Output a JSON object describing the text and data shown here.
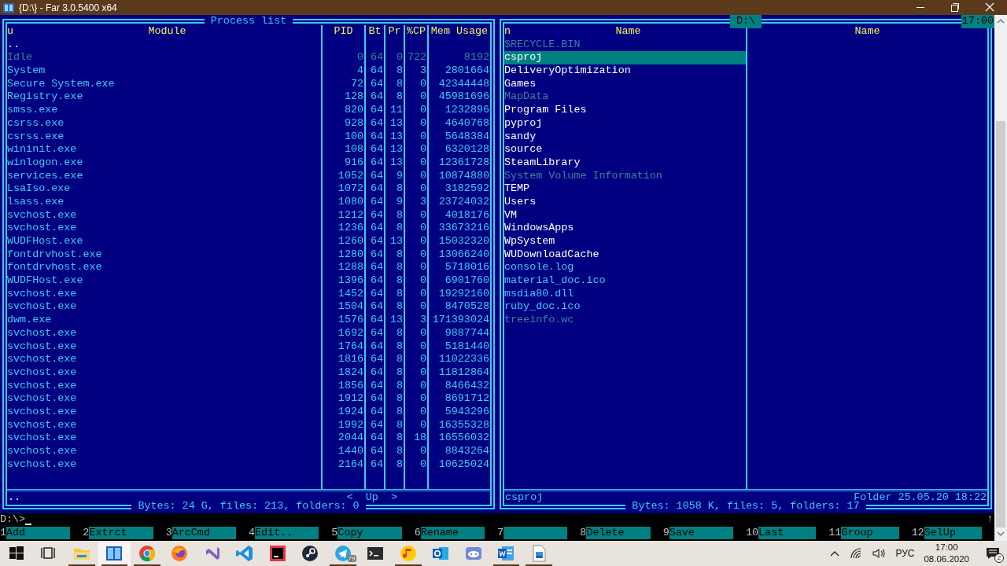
{
  "window": {
    "title": "{D:\\} - Far 3.0.5400 x64"
  },
  "left_panel": {
    "title": "Process list",
    "active": false,
    "columns": [
      {
        "label": "Module",
        "sort_mark": "u"
      },
      {
        "label": "PID"
      },
      {
        "label": "Bt"
      },
      {
        "label": "Pr"
      },
      {
        "label": "%CP"
      },
      {
        "label": "Mem Usage"
      }
    ],
    "rows": [
      {
        "kind": "up",
        "dim": false,
        "cells": [
          ".."
        ]
      },
      {
        "kind": "process",
        "dim": true,
        "cells": [
          "Idle",
          "0",
          "64",
          "0",
          "722",
          "8192"
        ]
      },
      {
        "kind": "process",
        "dim": false,
        "cells": [
          "System",
          "4",
          "64",
          "8",
          "3",
          "2801664"
        ]
      },
      {
        "kind": "process",
        "dim": false,
        "cells": [
          "Secure System.exe",
          "72",
          "64",
          "8",
          "0",
          "42344448"
        ]
      },
      {
        "kind": "process",
        "dim": false,
        "cells": [
          "Registry.exe",
          "128",
          "64",
          "8",
          "0",
          "45981696"
        ]
      },
      {
        "kind": "process",
        "dim": false,
        "cells": [
          "smss.exe",
          "820",
          "64",
          "11",
          "0",
          "1232896"
        ]
      },
      {
        "kind": "process",
        "dim": false,
        "cells": [
          "csrss.exe",
          "928",
          "64",
          "13",
          "0",
          "4640768"
        ]
      },
      {
        "kind": "process",
        "dim": false,
        "cells": [
          "csrss.exe",
          "100",
          "64",
          "13",
          "0",
          "5648384"
        ]
      },
      {
        "kind": "process",
        "dim": false,
        "cells": [
          "wininit.exe",
          "108",
          "64",
          "13",
          "0",
          "6320128"
        ]
      },
      {
        "kind": "process",
        "dim": false,
        "cells": [
          "winlogon.exe",
          "916",
          "64",
          "13",
          "0",
          "12361728"
        ]
      },
      {
        "kind": "process",
        "dim": false,
        "cells": [
          "services.exe",
          "1052",
          "64",
          "9",
          "0",
          "10874880"
        ]
      },
      {
        "kind": "process",
        "dim": false,
        "cells": [
          "LsaIso.exe",
          "1072",
          "64",
          "8",
          "0",
          "3182592"
        ]
      },
      {
        "kind": "process",
        "dim": false,
        "cells": [
          "lsass.exe",
          "1080",
          "64",
          "9",
          "3",
          "23724032"
        ]
      },
      {
        "kind": "process",
        "dim": false,
        "cells": [
          "svchost.exe",
          "1212",
          "64",
          "8",
          "0",
          "4018176"
        ]
      },
      {
        "kind": "process",
        "dim": false,
        "cells": [
          "svchost.exe",
          "1236",
          "64",
          "8",
          "0",
          "33673216"
        ]
      },
      {
        "kind": "process",
        "dim": false,
        "cells": [
          "WUDFHost.exe",
          "1260",
          "64",
          "13",
          "0",
          "15032320"
        ]
      },
      {
        "kind": "process",
        "dim": false,
        "cells": [
          "fontdrvhost.exe",
          "1280",
          "64",
          "8",
          "0",
          "13066240"
        ]
      },
      {
        "kind": "process",
        "dim": false,
        "cells": [
          "fontdrvhost.exe",
          "1288",
          "64",
          "8",
          "0",
          "5718016"
        ]
      },
      {
        "kind": "process",
        "dim": false,
        "cells": [
          "WUDFHost.exe",
          "1396",
          "64",
          "8",
          "0",
          "6901760"
        ]
      },
      {
        "kind": "process",
        "dim": false,
        "cells": [
          "svchost.exe",
          "1452",
          "64",
          "8",
          "0",
          "19292160"
        ]
      },
      {
        "kind": "process",
        "dim": false,
        "cells": [
          "svchost.exe",
          "1504",
          "64",
          "8",
          "0",
          "8470528"
        ]
      },
      {
        "kind": "process",
        "dim": false,
        "cells": [
          "dwm.exe",
          "1576",
          "64",
          "13",
          "3",
          "171393024"
        ]
      },
      {
        "kind": "process",
        "dim": false,
        "cells": [
          "svchost.exe",
          "1692",
          "64",
          "8",
          "0",
          "9887744"
        ]
      },
      {
        "kind": "process",
        "dim": false,
        "cells": [
          "svchost.exe",
          "1764",
          "64",
          "8",
          "0",
          "5181440"
        ]
      },
      {
        "kind": "process",
        "dim": false,
        "cells": [
          "svchost.exe",
          "1816",
          "64",
          "8",
          "0",
          "11022336"
        ]
      },
      {
        "kind": "process",
        "dim": false,
        "cells": [
          "svchost.exe",
          "1824",
          "64",
          "8",
          "0",
          "11812864"
        ]
      },
      {
        "kind": "process",
        "dim": false,
        "cells": [
          "svchost.exe",
          "1856",
          "64",
          "8",
          "0",
          "8466432"
        ]
      },
      {
        "kind": "process",
        "dim": false,
        "cells": [
          "svchost.exe",
          "1912",
          "64",
          "8",
          "0",
          "8691712"
        ]
      },
      {
        "kind": "process",
        "dim": false,
        "cells": [
          "svchost.exe",
          "1924",
          "64",
          "8",
          "0",
          "5943296"
        ]
      },
      {
        "kind": "process",
        "dim": false,
        "cells": [
          "svchost.exe",
          "1992",
          "64",
          "8",
          "0",
          "16355328"
        ]
      },
      {
        "kind": "process",
        "dim": false,
        "cells": [
          "svchost.exe",
          "2044",
          "64",
          "8",
          "18",
          "16556032"
        ]
      },
      {
        "kind": "process",
        "dim": false,
        "cells": [
          "svchost.exe",
          "1440",
          "64",
          "8",
          "0",
          "8843264"
        ]
      },
      {
        "kind": "process",
        "dim": false,
        "cells": [
          "svchost.exe",
          "2164",
          "64",
          "8",
          "0",
          "10625024"
        ]
      }
    ],
    "status": {
      "name": "..",
      "nav": "<  Up  >"
    },
    "totals": "Bytes: 24 G, files: 213, folders: 0"
  },
  "right_panel": {
    "title": "D:\\",
    "active": true,
    "columns": [
      {
        "label": "Name",
        "sort_mark": "n"
      },
      {
        "label": "Name"
      }
    ],
    "items": [
      {
        "name": "$RECYCLE.BIN",
        "kind": "folder",
        "dim": true,
        "selected": false
      },
      {
        "name": "csproj",
        "kind": "folder",
        "dim": false,
        "selected": true
      },
      {
        "name": "DeliveryOptimization",
        "kind": "folder",
        "dim": false,
        "selected": false
      },
      {
        "name": "Games",
        "kind": "folder",
        "dim": false,
        "selected": false
      },
      {
        "name": "MapData",
        "kind": "folder",
        "dim": true,
        "selected": false
      },
      {
        "name": "Program Files",
        "kind": "folder",
        "dim": false,
        "selected": false
      },
      {
        "name": "pyproj",
        "kind": "folder",
        "dim": false,
        "selected": false
      },
      {
        "name": "sandy",
        "kind": "folder",
        "dim": false,
        "selected": false
      },
      {
        "name": "source",
        "kind": "folder",
        "dim": false,
        "selected": false
      },
      {
        "name": "SteamLibrary",
        "kind": "folder",
        "dim": false,
        "selected": false
      },
      {
        "name": "System Volume Information",
        "kind": "folder",
        "dim": true,
        "selected": false
      },
      {
        "name": "TEMP",
        "kind": "folder",
        "dim": false,
        "selected": false
      },
      {
        "name": "Users",
        "kind": "folder",
        "dim": false,
        "selected": false
      },
      {
        "name": "VM",
        "kind": "folder",
        "dim": false,
        "selected": false
      },
      {
        "name": "WindowsApps",
        "kind": "folder",
        "dim": false,
        "selected": false
      },
      {
        "name": "WpSystem",
        "kind": "folder",
        "dim": false,
        "selected": false
      },
      {
        "name": "WUDownloadCache",
        "kind": "folder",
        "dim": false,
        "selected": false
      },
      {
        "name": "console.log",
        "kind": "file",
        "dim": false,
        "selected": false
      },
      {
        "name": "material_doc.ico",
        "kind": "file",
        "dim": false,
        "selected": false
      },
      {
        "name": "msdia80.dll",
        "kind": "file",
        "dim": false,
        "selected": false
      },
      {
        "name": "ruby_doc.ico",
        "kind": "file",
        "dim": false,
        "selected": false
      },
      {
        "name": "treeinfo.wc",
        "kind": "file",
        "dim": true,
        "selected": false
      }
    ],
    "status": {
      "name": "csproj",
      "info": "Folder 25.05.20 18:22"
    },
    "totals": "Bytes: 1058 K, files: 5, folders: 17"
  },
  "clock": "17:00",
  "command_line": {
    "prompt": "D:\\>",
    "scroll_mark": "↑"
  },
  "keybar": [
    {
      "key": "1",
      "label": "Add"
    },
    {
      "key": "2",
      "label": "Extrct"
    },
    {
      "key": "3",
      "label": "ArcCmd"
    },
    {
      "key": "4",
      "label": "Edit.."
    },
    {
      "key": "5",
      "label": "Copy"
    },
    {
      "key": "6",
      "label": "Rename"
    },
    {
      "key": "7"
    },
    {
      "key": "8",
      "label": "Delete"
    },
    {
      "key": "9",
      "label": "Save"
    },
    {
      "key": "10",
      "label": "Last"
    },
    {
      "key": "11",
      "label": "Group"
    },
    {
      "key": "12",
      "label": "SelUp"
    }
  ],
  "taskbar": {
    "apps": [
      {
        "kind": "start",
        "running": false,
        "active": false
      },
      {
        "kind": "task-view",
        "running": false,
        "active": false
      },
      {
        "kind": "folder",
        "running": true,
        "active": false
      },
      {
        "kind": "panels",
        "running": true,
        "active": true
      },
      {
        "kind": "ring-circle",
        "running": true,
        "active": false
      },
      {
        "kind": "swirl-circle",
        "running": false,
        "active": false
      },
      {
        "kind": "ribbon-violet",
        "running": false,
        "active": false
      },
      {
        "kind": "ribbon-blue",
        "running": false,
        "active": false
      },
      {
        "kind": "tile",
        "running": false,
        "active": false
      },
      {
        "kind": "disc",
        "running": false,
        "active": false
      },
      {
        "kind": "paper-plane",
        "running": true,
        "active": false,
        "badge": "79"
      },
      {
        "kind": "terminal",
        "running": false,
        "active": false
      },
      {
        "kind": "music-note",
        "running": true,
        "active": false
      },
      {
        "kind": "envelope",
        "running": false,
        "active": false
      },
      {
        "kind": "gamepad",
        "running": false,
        "active": false
      },
      {
        "kind": "document",
        "running": true,
        "active": false
      },
      {
        "kind": "image-file",
        "running": true,
        "active": false
      }
    ],
    "tray": {
      "language": "РУС",
      "time": "17:00",
      "date": "08.06.2020",
      "notifications": "2"
    }
  }
}
